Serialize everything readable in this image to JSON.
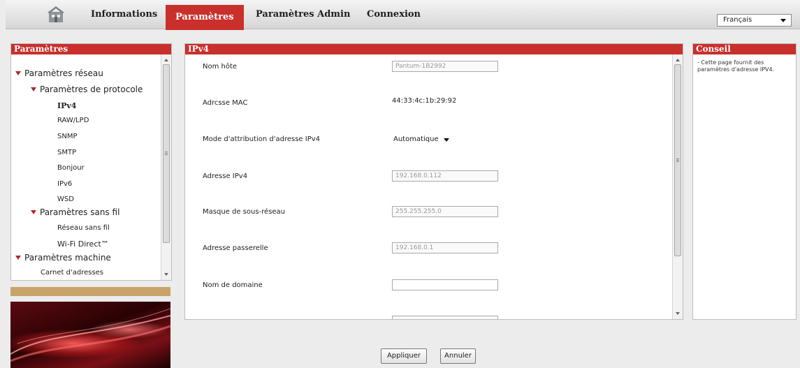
{
  "nav": {
    "home_icon": "house-icon",
    "tabs": [
      {
        "label": "Informations"
      },
      {
        "label": "Paramètres"
      },
      {
        "label": "Paramètres Admin"
      },
      {
        "label": "Connexion"
      }
    ],
    "language": "Français"
  },
  "left_panel": {
    "title": "Paramètres",
    "tree": [
      {
        "label": "Paramètres réseau"
      },
      {
        "label": "Paramètres de protocole"
      },
      {
        "label": "IPv4"
      },
      {
        "label": "RAW/LPD"
      },
      {
        "label": "SNMP"
      },
      {
        "label": "SMTP"
      },
      {
        "label": "Bonjour"
      },
      {
        "label": "IPv6"
      },
      {
        "label": "WSD"
      },
      {
        "label": "Paramètres sans fil"
      },
      {
        "label": "Réseau sans fil"
      },
      {
        "label": "Wi-Fi Direct™"
      },
      {
        "label": "Paramètres machine"
      },
      {
        "label": "Carnet d'adresses"
      }
    ]
  },
  "main": {
    "title": "IPv4",
    "fields": {
      "hostname": {
        "label": "Nom hôte",
        "value": "Pantum-1B2992"
      },
      "mac": {
        "label": "Adrcsse MAC",
        "value": "44:33:4c:1b:29:92"
      },
      "mode": {
        "label": "Mode d'attribution d'adresse IPv4",
        "value": "Automatique"
      },
      "ip": {
        "label": "Adresse IPv4",
        "value": "192.168.0.112"
      },
      "mask": {
        "label": "Masque de sous-réseau",
        "value": "255.255.255.0"
      },
      "gateway": {
        "label": "Adresse passerelle",
        "value": "192.168.0.1"
      },
      "domain": {
        "label": "Nom de domaine",
        "value": ""
      }
    }
  },
  "tip_panel": {
    "title": "Conseil",
    "text": "- Cette page fournit des paramètres d'adresse IPV4."
  },
  "buttons": {
    "apply": "Appliquer",
    "cancel": "Annuler"
  },
  "colors": {
    "accent": "#c9302c",
    "tree_marker": "#b02530",
    "gold_band": "#c9a46a"
  }
}
